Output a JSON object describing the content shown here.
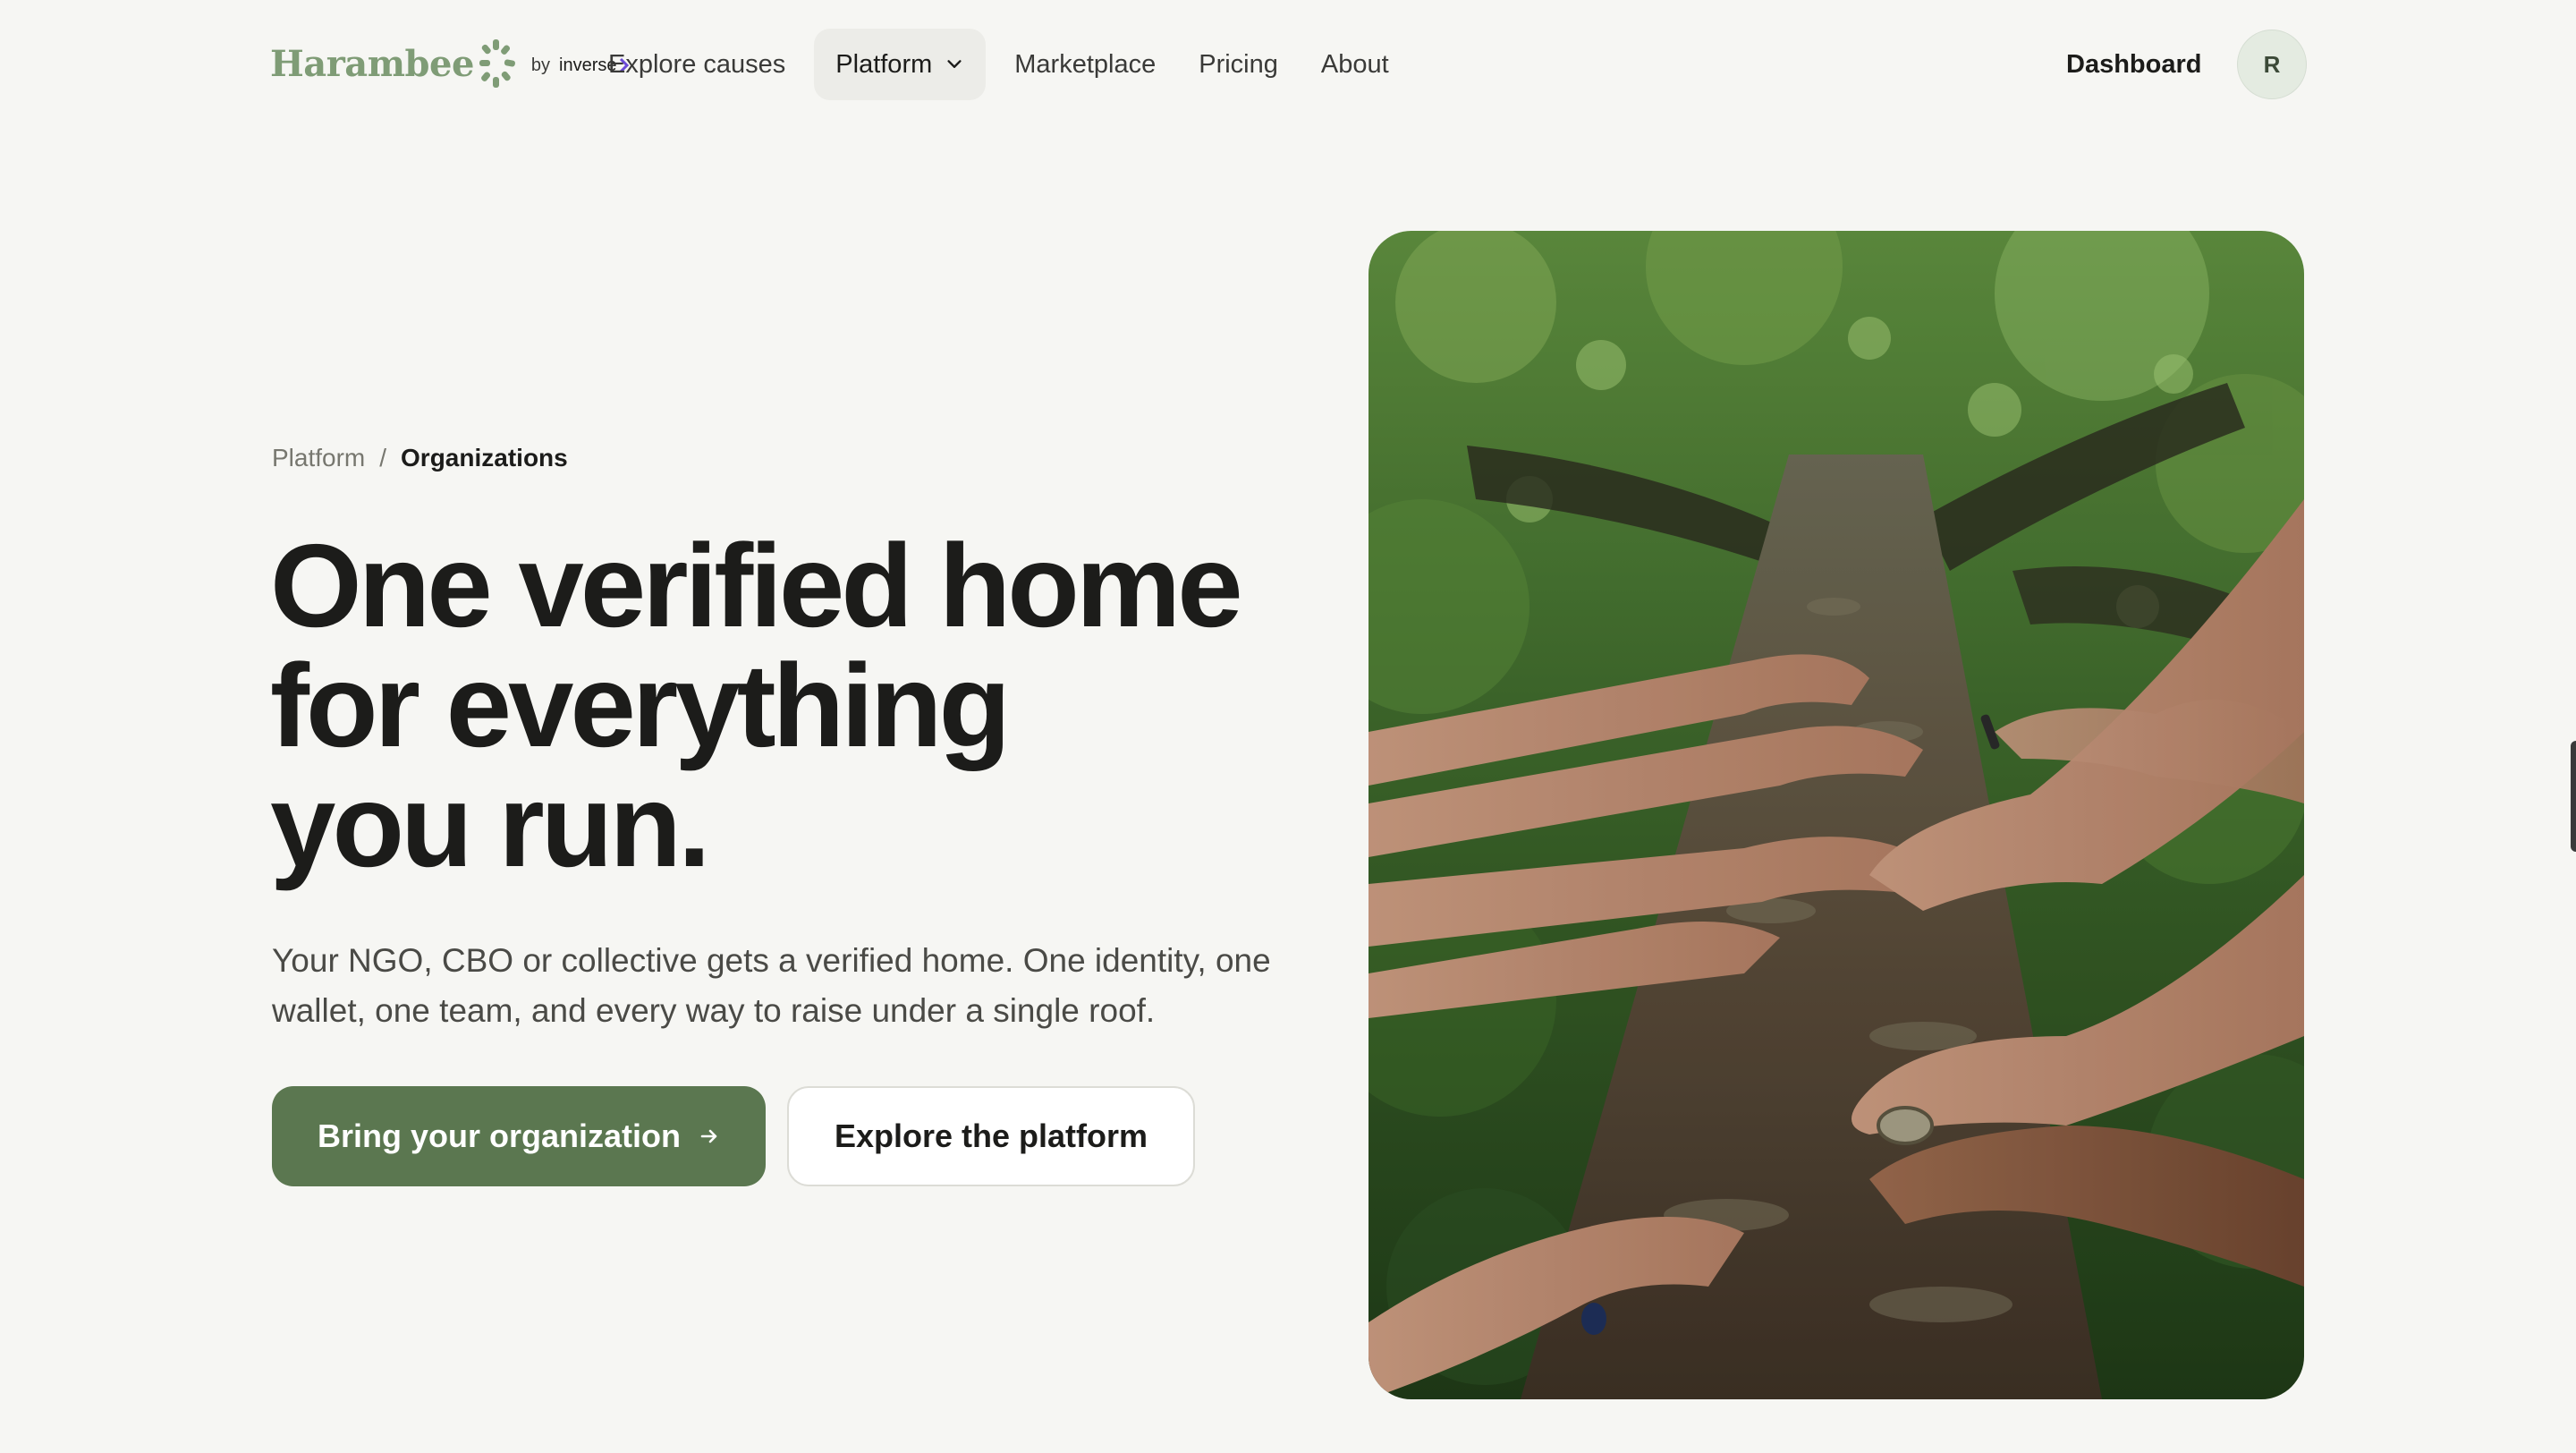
{
  "header": {
    "logo": {
      "name": "Harambee",
      "by": "by",
      "partner": "inverse"
    },
    "nav": [
      {
        "label": "Explore causes"
      },
      {
        "label": "Platform",
        "has_dropdown": true,
        "active": true
      },
      {
        "label": "Marketplace"
      },
      {
        "label": "Pricing"
      },
      {
        "label": "About"
      }
    ],
    "dashboard_label": "Dashboard",
    "avatar_initial": "R"
  },
  "breadcrumb": {
    "parent": "Platform",
    "separator": "/",
    "current": "Organizations"
  },
  "hero": {
    "title_lines": [
      "One verified home",
      "for everything",
      "you run."
    ],
    "subtitle_lines": [
      "Your NGO, CBO or collective gets a verified home. One identity, one",
      "wallet, one team, and every way to raise under a single roof."
    ],
    "primary_cta": "Bring your organization",
    "secondary_cta": "Explore the platform"
  },
  "colors": {
    "background": "#f6f6f3",
    "brand_green": "#7f9c76",
    "primary_button": "#5b7750",
    "text": "#1c1c1a",
    "muted_text": "#77776f"
  },
  "icons": {
    "dropdown": "chevron-down-icon",
    "cta_arrow": "arrow-right-icon",
    "logo_mark": "sunburst-icon"
  }
}
